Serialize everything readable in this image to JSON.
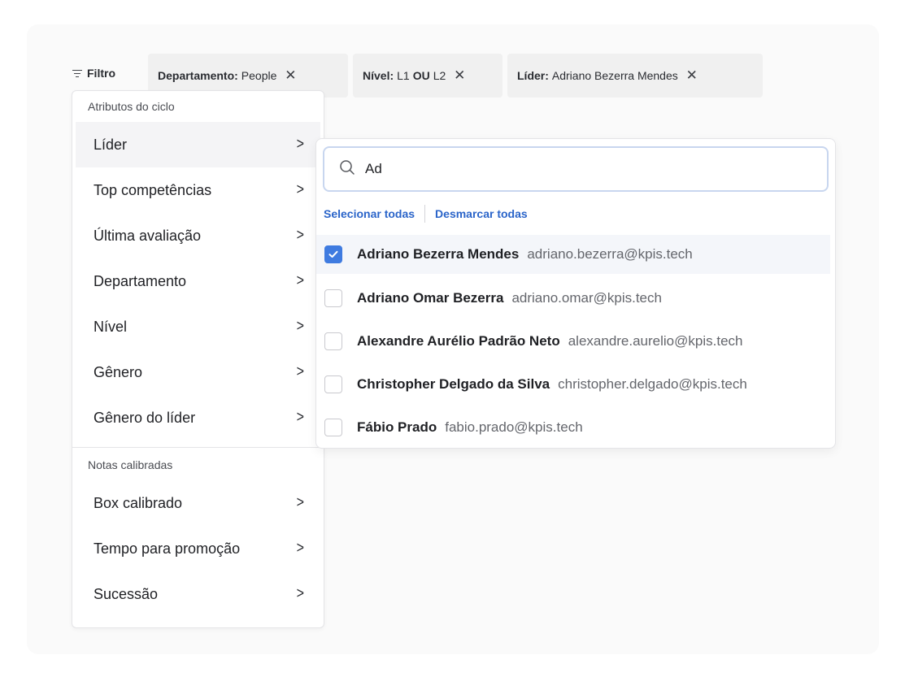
{
  "filter": {
    "label": "Filtro"
  },
  "chips": [
    {
      "key": "Departamento:",
      "value": "People"
    },
    {
      "key": "Nível:",
      "v1": "L1",
      "op": "OU",
      "v2": "L2"
    },
    {
      "key": "Líder:",
      "value": "Adriano Bezerra Mendes"
    }
  ],
  "menu": {
    "section1": "Atributos do ciclo",
    "items1": [
      "Líder",
      "Top competências",
      "Última avaliação",
      "Departamento",
      "Nível",
      "Gênero",
      "Gênero do líder"
    ],
    "section2": "Notas calibradas",
    "items2": [
      "Box calibrado",
      "Tempo para promoção",
      "Sucessão"
    ]
  },
  "dropdown": {
    "search_value": "Ad",
    "select_all": "Selecionar todas",
    "deselect_all": "Desmarcar todas",
    "options": [
      {
        "name": "Adriano Bezerra Mendes",
        "email": "adriano.bezerra@kpis.tech",
        "checked": true
      },
      {
        "name": "Adriano Omar Bezerra",
        "email": "adriano.omar@kpis.tech",
        "checked": false
      },
      {
        "name": "Alexandre Aurélio Padrão Neto",
        "email": "alexandre.aurelio@kpis.tech",
        "checked": false
      },
      {
        "name": "Christopher Delgado da Silva",
        "email": "christopher.delgado@kpis.tech",
        "checked": false
      },
      {
        "name": "Fábio Prado",
        "email": "fabio.prado@kpis.tech",
        "checked": false
      }
    ]
  },
  "colors": {
    "accent": "#3f7be0",
    "link": "#2a64c9"
  }
}
